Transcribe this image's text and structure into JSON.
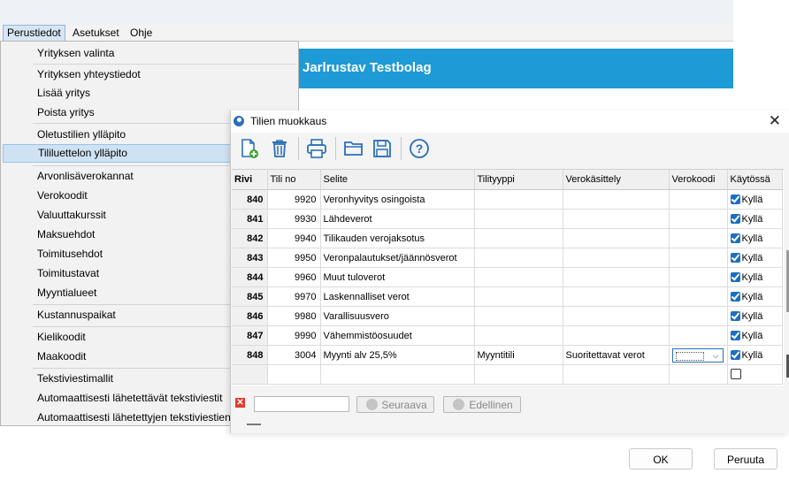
{
  "menubar": {
    "items": [
      "Perustiedot",
      "Asetukset",
      "Ohje"
    ]
  },
  "banner": {
    "company": "Jarlrustav Testbolag"
  },
  "dropdown": {
    "items": [
      "Yrityksen valinta",
      "Yrityksen yhteystiedot",
      "Lisää yritys",
      "Poista yritys",
      "Oletustilien ylläpito",
      "Tililuettelon ylläpito",
      "Arvonlisäverokannat",
      "Verokoodit",
      "Valuuttakurssit",
      "Maksuehdot",
      "Toimitusehdot",
      "Toimitustavat",
      "Myyntialueet",
      "Kustannuspaikat",
      "Kielikoodit",
      "Maakoodit",
      "Tekstiviestimallit",
      "Automaattisesti lähetettävät tekstiviestit",
      "Automaattisesti lähetettyjen tekstiviestien"
    ]
  },
  "dialog": {
    "title": "Tilien muokkaus",
    "close": "✕",
    "columns": [
      "Rivi",
      "Tili no",
      "Selite",
      "Tilityyppi",
      "Verokäsittely",
      "Verokoodi",
      "Käytössä"
    ],
    "rows": [
      {
        "rivi": "840",
        "tili": "9920",
        "selite": "Veronhyvitys osingoista",
        "tyyppi": "",
        "vero": "",
        "koodi": "",
        "kaytossa": "Kyllä"
      },
      {
        "rivi": "841",
        "tili": "9930",
        "selite": "Lähdeverot",
        "tyyppi": "",
        "vero": "",
        "koodi": "",
        "kaytossa": "Kyllä"
      },
      {
        "rivi": "842",
        "tili": "9940",
        "selite": "Tilikauden verojaksotus",
        "tyyppi": "",
        "vero": "",
        "koodi": "",
        "kaytossa": "Kyllä"
      },
      {
        "rivi": "843",
        "tili": "9950",
        "selite": "Veronpalautukset/jäännösverot",
        "tyyppi": "",
        "vero": "",
        "koodi": "",
        "kaytossa": "Kyllä"
      },
      {
        "rivi": "844",
        "tili": "9960",
        "selite": "Muut tuloverot",
        "tyyppi": "",
        "vero": "",
        "koodi": "",
        "kaytossa": "Kyllä"
      },
      {
        "rivi": "845",
        "tili": "9970",
        "selite": "Laskennalliset verot",
        "tyyppi": "",
        "vero": "",
        "koodi": "",
        "kaytossa": "Kyllä"
      },
      {
        "rivi": "846",
        "tili": "9980",
        "selite": "Varallisuusvero",
        "tyyppi": "",
        "vero": "",
        "koodi": "",
        "kaytossa": "Kyllä"
      },
      {
        "rivi": "847",
        "tili": "9990",
        "selite": "Vähemmistöosuudet",
        "tyyppi": "",
        "vero": "",
        "koodi": "",
        "kaytossa": "Kyllä"
      },
      {
        "rivi": "848",
        "tili": "3004",
        "selite": "Myynti alv 25,5%",
        "tyyppi": "Myyntitili",
        "vero": "Suoritettavat verot",
        "koodi": "",
        "kaytossa": "Kyllä"
      }
    ],
    "find": {
      "next": "Seuraava",
      "prev": "Edellinen"
    }
  },
  "buttons": {
    "ok": "OK",
    "cancel": "Peruuta"
  },
  "colors": {
    "accent": "#1e9ad6",
    "highlight": "#cfe2f3",
    "check": "#1b6ec2"
  }
}
